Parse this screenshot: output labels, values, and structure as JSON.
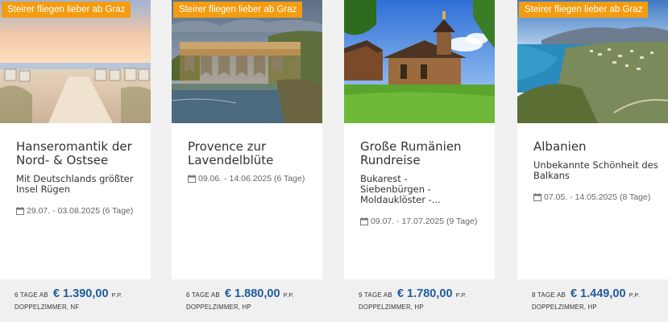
{
  "cards": [
    {
      "badge": "Steirer fliegen lieber ab Graz",
      "title": "Hanseromantik der Nord- & Ostsee",
      "subtitle": "Mit Deutschlands größter Insel Rügen",
      "date": "29.07. - 03.08.2025 (6 Tage)",
      "from": "6 TAGE AB",
      "price": "€ 1.390,00",
      "pp": "P.P.",
      "room": "DOPPELZIMMER, NF",
      "image_icon": "beach-scene"
    },
    {
      "badge": "Steirer fliegen lieber ab Graz",
      "title": "Provence zur Lavendelblüte",
      "subtitle": "",
      "date": "09.06. - 14.06.2025 (6 Tage)",
      "from": "6 TAGE AB",
      "price": "€ 1.880,00",
      "pp": "P.P.",
      "room": "DOPPELZIMMER, HP",
      "image_icon": "aqueduct-scene"
    },
    {
      "badge": "",
      "title": "Große Rumänien Rundreise",
      "subtitle": "Bukarest - Siebenbürgen - Moldauklöster -...",
      "date": "09.07. - 17.07.2025 (9 Tage)",
      "from": "9 TAGE AB",
      "price": "€ 1.780,00",
      "pp": "P.P.",
      "room": "DOPPELZIMMER, HP",
      "image_icon": "monastery-scene"
    },
    {
      "badge": "Steirer fliegen lieber ab Graz",
      "title": "Albanien",
      "subtitle": "Unbekannte Schönheit des Balkans",
      "date": "07.05. - 14.05.2025 (8 Tage)",
      "from": "8 TAGE AB",
      "price": "€ 1.449,00",
      "pp": "P.P.",
      "room": "DOPPELZIMMER, HP",
      "image_icon": "coast-scene"
    }
  ],
  "colors": {
    "badge": "#f39c12",
    "price": "#1f5b9e",
    "footer": "#f0f0f0"
  }
}
